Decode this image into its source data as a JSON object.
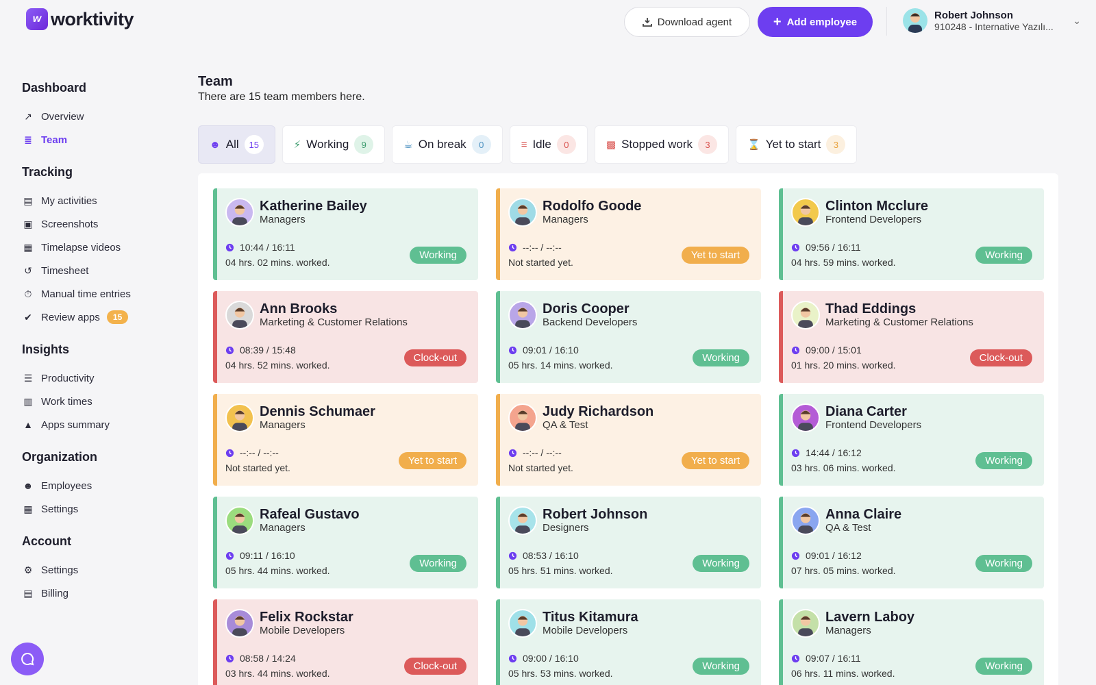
{
  "app": {
    "name": "worktivity"
  },
  "header": {
    "download_label": "Download agent",
    "add_label": "Add employee",
    "user_name": "Robert Johnson",
    "user_org": "910248 - Internative Yazılı..."
  },
  "sidebar": {
    "sections": [
      {
        "title": "Dashboard",
        "items": [
          {
            "label": "Overview",
            "icon": "chart-line-icon"
          },
          {
            "label": "Team",
            "icon": "layers-icon",
            "active": true
          }
        ]
      },
      {
        "title": "Tracking",
        "items": [
          {
            "label": "My activities",
            "icon": "id-card-icon"
          },
          {
            "label": "Screenshots",
            "icon": "images-icon"
          },
          {
            "label": "Timelapse videos",
            "icon": "film-icon"
          },
          {
            "label": "Timesheet",
            "icon": "history-icon"
          },
          {
            "label": "Manual time entries",
            "icon": "stopwatch-icon"
          },
          {
            "label": "Review apps",
            "icon": "check-circle-icon",
            "badge": "15"
          }
        ]
      },
      {
        "title": "Insights",
        "items": [
          {
            "label": "Productivity",
            "icon": "list-check-icon"
          },
          {
            "label": "Work times",
            "icon": "business-time-icon"
          },
          {
            "label": "Apps summary",
            "icon": "shapes-icon"
          }
        ]
      },
      {
        "title": "Organization",
        "items": [
          {
            "label": "Employees",
            "icon": "users-icon"
          },
          {
            "label": "Settings",
            "icon": "building-icon"
          }
        ]
      },
      {
        "title": "Account",
        "items": [
          {
            "label": "Settings",
            "icon": "user-cog-icon"
          },
          {
            "label": "Billing",
            "icon": "invoice-icon"
          }
        ]
      }
    ]
  },
  "main": {
    "title": "Team",
    "subtitle": "There are 15 team members here."
  },
  "filters": [
    {
      "label": "All",
      "count": "15",
      "icon": "users-icon",
      "count_bg": "#ffffff",
      "count_fg": "#6d3ef0",
      "active": true
    },
    {
      "label": "Working",
      "count": "9",
      "icon": "bolt-icon",
      "count_bg": "#dff3e8",
      "count_fg": "#3f9d70"
    },
    {
      "label": "On break",
      "count": "0",
      "icon": "coffee-icon",
      "count_bg": "#e4f0f8",
      "count_fg": "#4a90c0"
    },
    {
      "label": "Idle",
      "count": "0",
      "icon": "bed-icon",
      "count_bg": "#fbe6e4",
      "count_fg": "#d9534f"
    },
    {
      "label": "Stopped work",
      "count": "3",
      "icon": "door-icon",
      "count_bg": "#fbe6e4",
      "count_fg": "#d9534f"
    },
    {
      "label": "Yet to start",
      "count": "3",
      "icon": "hourglass-icon",
      "count_bg": "#fcf0df",
      "count_fg": "#e8a23c"
    }
  ],
  "members": [
    {
      "name": "Katherine Bailey",
      "team": "Managers",
      "time": "10:44 / 16:11",
      "worked": "04 hrs. 02 mins. worked.",
      "status": "Working",
      "kind": "working",
      "avatar_color": "#c9b8f0"
    },
    {
      "name": "Rodolfo Goode",
      "team": "Managers",
      "time": "--:-- / --:--",
      "worked": "Not started yet.",
      "status": "Yet to start",
      "kind": "yet",
      "avatar_color": "#9fdbe6"
    },
    {
      "name": "Clinton Mcclure",
      "team": "Frontend Developers",
      "time": "09:56 / 16:11",
      "worked": "04 hrs. 59 mins. worked.",
      "status": "Working",
      "kind": "working",
      "avatar_color": "#f2c94c"
    },
    {
      "name": "Ann Brooks",
      "team": "Marketing & Customer Relations",
      "time": "08:39 / 15:48",
      "worked": "04 hrs. 52 mins. worked.",
      "status": "Clock-out",
      "kind": "clock",
      "avatar_color": "#d9d9d9"
    },
    {
      "name": "Doris Cooper",
      "team": "Backend Developers",
      "time": "09:01 / 16:10",
      "worked": "05 hrs. 14 mins. worked.",
      "status": "Working",
      "kind": "working",
      "avatar_color": "#b9a6e8"
    },
    {
      "name": "Thad Eddings",
      "team": "Marketing & Customer Relations",
      "time": "09:00 / 15:01",
      "worked": "01 hrs. 20 mins. worked.",
      "status": "Clock-out",
      "kind": "clock",
      "avatar_color": "#e9f2c8"
    },
    {
      "name": "Dennis Schumaer",
      "team": "Managers",
      "time": "--:-- / --:--",
      "worked": "Not started yet.",
      "status": "Yet to start",
      "kind": "yet",
      "avatar_color": "#f2c14e"
    },
    {
      "name": "Judy Richardson",
      "team": "QA & Test",
      "time": "--:-- / --:--",
      "worked": "Not started yet.",
      "status": "Yet to start",
      "kind": "yet",
      "avatar_color": "#f4a48e"
    },
    {
      "name": "Diana Carter",
      "team": "Frontend Developers",
      "time": "14:44 / 16:12",
      "worked": "03 hrs. 06 mins. worked.",
      "status": "Working",
      "kind": "working",
      "avatar_color": "#b45cd6"
    },
    {
      "name": "Rafeal Gustavo",
      "team": "Managers",
      "time": "09:11 / 16:10",
      "worked": "05 hrs. 44 mins. worked.",
      "status": "Working",
      "kind": "working",
      "avatar_color": "#9bdc7e"
    },
    {
      "name": "Robert Johnson",
      "team": "Designers",
      "time": "08:53 / 16:10",
      "worked": "05 hrs. 51 mins. worked.",
      "status": "Working",
      "kind": "working",
      "avatar_color": "#a7e3ea"
    },
    {
      "name": "Anna Claire",
      "team": "QA & Test",
      "time": "09:01 / 16:12",
      "worked": "07 hrs. 05 mins. worked.",
      "status": "Working",
      "kind": "working",
      "avatar_color": "#8aa6f0"
    },
    {
      "name": "Felix Rockstar",
      "team": "Mobile Developers",
      "time": "08:58 / 14:24",
      "worked": "03 hrs. 44 mins. worked.",
      "status": "Clock-out",
      "kind": "clock",
      "avatar_color": "#a78bd8"
    },
    {
      "name": "Titus Kitamura",
      "team": "Mobile Developers",
      "time": "09:00 / 16:10",
      "worked": "05 hrs. 53 mins. worked.",
      "status": "Working",
      "kind": "working",
      "avatar_color": "#9fe0e8"
    },
    {
      "name": "Lavern Laboy",
      "team": "Managers",
      "time": "09:07 / 16:11",
      "worked": "06 hrs. 11 mins. worked.",
      "status": "Working",
      "kind": "working",
      "avatar_color": "#c4e0a8"
    }
  ]
}
